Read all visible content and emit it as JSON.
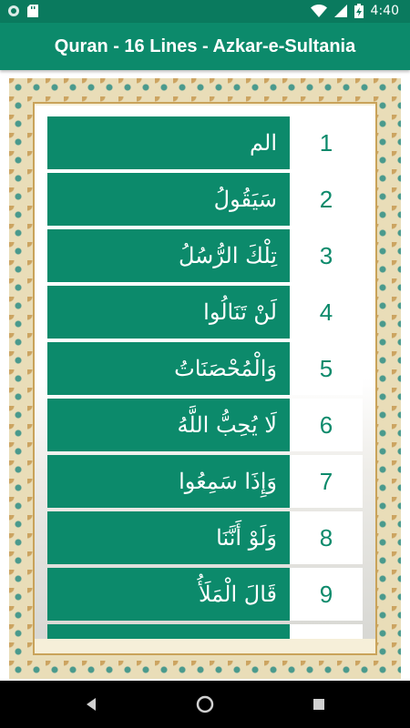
{
  "status_bar": {
    "time": "4:40",
    "icons": [
      "circle-notification-icon",
      "sd-card-icon",
      "wifi-icon",
      "cellular-signal-icon",
      "battery-charging-icon"
    ]
  },
  "app_bar": {
    "title": "Quran - 16 Lines - Azkar-e-Sultania"
  },
  "colors": {
    "primary": "#0c8a6b",
    "status_bar": "#0a7a5e",
    "row_number_text": "#0c8a6b",
    "frame_gold": "#c9a35a"
  },
  "parts": [
    {
      "number": "1",
      "title": "الم"
    },
    {
      "number": "2",
      "title": "سَيَقُولُ"
    },
    {
      "number": "3",
      "title": "تِلْكَ الرُّسُلُ"
    },
    {
      "number": "4",
      "title": "لَنْ تَنَالُوا"
    },
    {
      "number": "5",
      "title": "وَالْمُحْصَنَاتُ"
    },
    {
      "number": "6",
      "title": "لَا يُحِبُّ اللَّهُ"
    },
    {
      "number": "7",
      "title": "وَإِذَا سَمِعُوا"
    },
    {
      "number": "8",
      "title": "وَلَوْ أَنَّنَا"
    },
    {
      "number": "9",
      "title": "قَالَ الْمَلَأُ"
    },
    {
      "number": "",
      "title": ""
    }
  ],
  "nav_bar": {
    "icons": [
      "back-icon",
      "home-icon",
      "recents-icon"
    ]
  }
}
